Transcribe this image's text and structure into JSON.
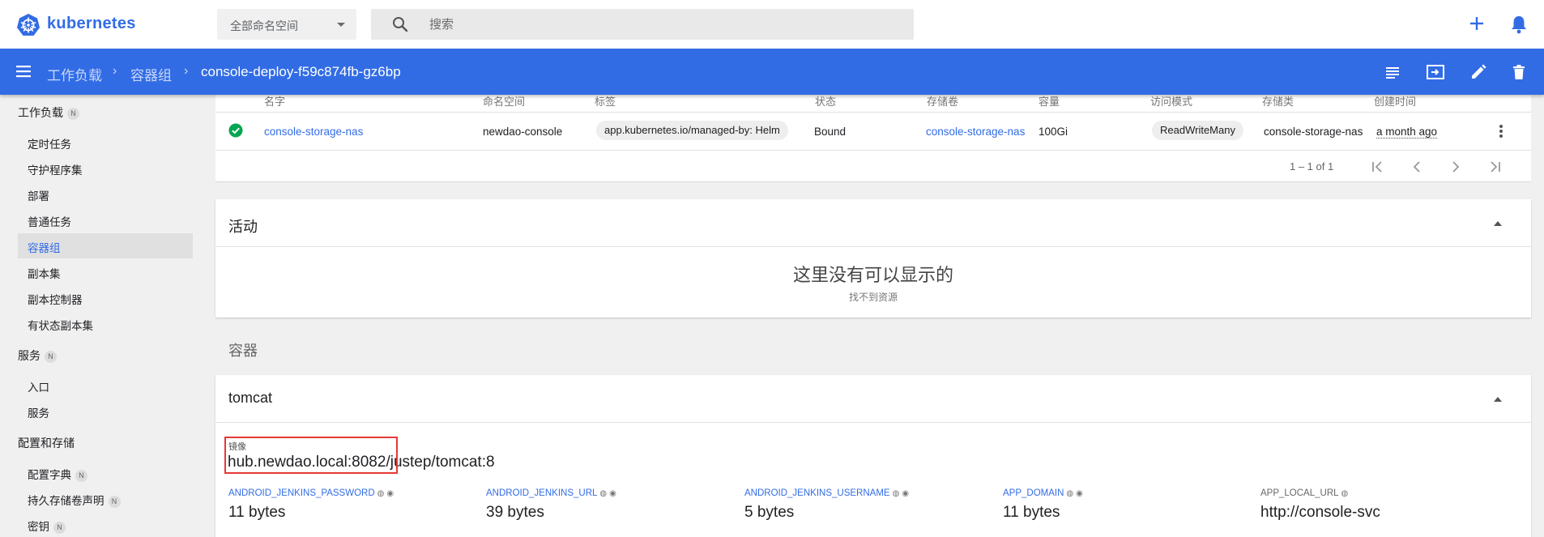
{
  "app": {
    "name": "kubernetes"
  },
  "topbar": {
    "namespace_selected": "全部命名空间",
    "search_placeholder": "搜索",
    "plus_icon": "plus-icon",
    "bell_icon": "bell-icon"
  },
  "breadcrumb": {
    "items": [
      "工作负载",
      "容器组"
    ],
    "current": "console-deploy-f59c874fb-gz6bp"
  },
  "actions": [
    "logs-icon",
    "exec-icon",
    "edit-icon",
    "delete-icon"
  ],
  "sidebar": {
    "sections": [
      {
        "label": "工作负载",
        "badge": "N",
        "items": [
          "定时任务",
          "守护程序集",
          "部署",
          "普通任务",
          "容器组",
          "副本集",
          "副本控制器",
          "有状态副本集"
        ]
      },
      {
        "label": "服务",
        "badge": "N",
        "items": [
          "入口",
          "服务"
        ]
      },
      {
        "label": "配置和存储",
        "badge": "",
        "items": [
          "配置字典",
          "持久存储卷声明",
          "密钥"
        ]
      }
    ],
    "item_badges": {
      "配置字典": "N",
      "持久存储卷声明": "N",
      "密钥": "N"
    },
    "active_item": "容器组"
  },
  "pvc_table": {
    "headers": [
      "名字",
      "命名空间",
      "标签",
      "状态",
      "存储卷",
      "容量",
      "访问模式",
      "存储类",
      "创建时间"
    ],
    "row": {
      "status_icon": "check-circle-icon",
      "name": "console-storage-nas",
      "namespace": "newdao-console",
      "label": "app.kubernetes.io/managed-by: Helm",
      "status": "Bound",
      "volume": "console-storage-nas",
      "capacity": "100Gi",
      "access_mode": "ReadWriteMany",
      "storage_class": "console-storage-nas",
      "created": "a month ago"
    },
    "pagination": "1 – 1 of 1"
  },
  "activity": {
    "title": "活动",
    "empty_title": "这里没有可以显示的",
    "empty_subtitle": "找不到资源"
  },
  "containers": {
    "section_title": "容器",
    "name": "tomcat",
    "image_label": "镜像",
    "image_highlight": "hub.newdao.local:8082",
    "image_rest": "/justep/tomcat:8",
    "highlight_color": "#e53935",
    "env": [
      {
        "key": "ANDROID_JENKINS_PASSWORD",
        "value": "11 bytes"
      },
      {
        "key": "ANDROID_JENKINS_URL",
        "value": "39 bytes"
      },
      {
        "key": "ANDROID_JENKINS_USERNAME",
        "value": "5 bytes"
      },
      {
        "key": "APP_DOMAIN",
        "value": "11 bytes"
      },
      {
        "key": "APP_LOCAL_URL",
        "value": "http://console-svc"
      }
    ]
  },
  "colors": {
    "brand_blue": "#326ce5",
    "success_green": "#00a651"
  }
}
